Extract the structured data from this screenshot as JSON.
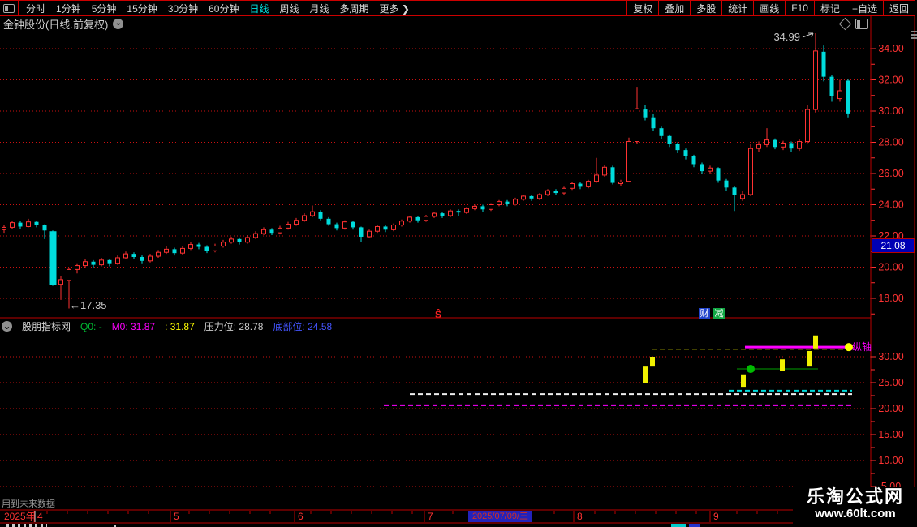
{
  "menu": {
    "left_items": [
      {
        "label": "分时",
        "active": false
      },
      {
        "label": "1分钟",
        "active": false
      },
      {
        "label": "5分钟",
        "active": false
      },
      {
        "label": "15分钟",
        "active": false
      },
      {
        "label": "30分钟",
        "active": false
      },
      {
        "label": "60分钟",
        "active": false
      },
      {
        "label": "日线",
        "active": true
      },
      {
        "label": "周线",
        "active": false
      },
      {
        "label": "月线",
        "active": false
      },
      {
        "label": "多周期",
        "active": false
      },
      {
        "label": "更多 ❯",
        "active": false
      }
    ],
    "right_items": [
      "复权",
      "叠加",
      "多股",
      "统计",
      "画线",
      "F10",
      "标记",
      "+自选",
      "返回"
    ]
  },
  "title_bar": {
    "title": "金钟股份(日线.前复权)",
    "chevron": "⌄"
  },
  "main_chart": {
    "axis": [
      {
        "label": "34.00",
        "value": 34
      },
      {
        "label": "32.00",
        "value": 32
      },
      {
        "label": "30.00",
        "value": 30
      },
      {
        "label": "28.00",
        "value": 28
      },
      {
        "label": "26.00",
        "value": 26
      },
      {
        "label": "24.00",
        "value": 24
      },
      {
        "label": "22.00",
        "value": 22
      },
      {
        "label": "20.00",
        "value": 20
      },
      {
        "label": "18.00",
        "value": 18
      }
    ],
    "price_tag": "21.08",
    "high_annotation": "34.99",
    "low_annotation": "←17.35",
    "event_marker": "Ŝ",
    "badges": [
      {
        "label": "财",
        "color": "#2244cc"
      },
      {
        "label": "减",
        "color": "#11a844"
      }
    ]
  },
  "indicator": {
    "name": "股朋指标网",
    "fields": [
      {
        "text": "Q0: -",
        "color": "#00bb33"
      },
      {
        "text": "M0: 31.87",
        "color": "#ff00ff"
      },
      {
        "text": ": 31.87",
        "color": "#ffff00"
      },
      {
        "text": "压力位: 28.78",
        "color": "#cccccc"
      },
      {
        "text": "底部位: 24.58",
        "color": "#4455ff"
      }
    ],
    "axis": [
      {
        "label": "30.00",
        "value": 30
      },
      {
        "label": "25.00",
        "value": 25
      },
      {
        "label": "20.00",
        "value": 20
      },
      {
        "label": "15.00",
        "value": 15
      },
      {
        "label": "10.00",
        "value": 10
      },
      {
        "label": "5.00",
        "value": 5
      }
    ],
    "side_label": "纵轴"
  },
  "footer": {
    "note": "用到未来数据",
    "year_label": "2025年",
    "months": [
      {
        "label": "4",
        "x": 46
      },
      {
        "label": "5",
        "x": 214
      },
      {
        "label": "6",
        "x": 367
      },
      {
        "label": "7",
        "x": 527
      },
      {
        "label": "8",
        "x": 711
      },
      {
        "label": "9",
        "x": 879
      }
    ],
    "highlight_date": "2025/07/09/三",
    "watermark_line1": "乐淘公式网",
    "watermark_line2": "www.60lt.com"
  },
  "chart_data": [
    {
      "type": "candlestick",
      "title": "金钟股份 日线 前复权 2025年4月-9月",
      "y_range": [
        17,
        35.5
      ],
      "grid_values": [
        34,
        32,
        30,
        28,
        26,
        24,
        22,
        20,
        18
      ],
      "up_color": "#ff3232",
      "down_color": "#00dcdc",
      "high": 34.99,
      "low": 17.35,
      "last_price_tag": 21.08,
      "candles": [
        [
          22.4,
          22.7,
          22.2,
          22.55
        ],
        [
          22.55,
          22.95,
          22.45,
          22.85
        ],
        [
          22.85,
          22.95,
          22.45,
          22.6
        ],
        [
          22.6,
          23.1,
          22.55,
          22.9
        ],
        [
          22.9,
          22.95,
          22.55,
          22.7
        ],
        [
          22.7,
          22.75,
          21.8,
          22.35
        ],
        [
          22.3,
          22.35,
          18.8,
          18.85,
          9
        ],
        [
          18.9,
          19.4,
          17.9,
          19.2
        ],
        [
          19.15,
          19.95,
          17.35,
          19.85
        ],
        [
          19.85,
          20.25,
          19.6,
          20.1
        ],
        [
          20.1,
          20.5,
          19.95,
          20.35
        ],
        [
          20.35,
          20.45,
          19.95,
          20.15
        ],
        [
          20.15,
          20.6,
          20.05,
          20.45
        ],
        [
          20.45,
          20.5,
          20.05,
          20.25
        ],
        [
          20.25,
          20.75,
          20.15,
          20.6
        ],
        [
          20.6,
          21.0,
          20.5,
          20.85
        ],
        [
          20.85,
          20.95,
          20.5,
          20.65
        ],
        [
          20.65,
          20.75,
          20.25,
          20.4
        ],
        [
          20.4,
          20.85,
          20.3,
          20.7
        ],
        [
          20.7,
          21.1,
          20.6,
          20.95
        ],
        [
          20.95,
          21.35,
          20.85,
          21.15
        ],
        [
          21.15,
          21.25,
          20.75,
          20.9
        ],
        [
          20.9,
          21.35,
          20.8,
          21.2
        ],
        [
          21.2,
          21.6,
          21.1,
          21.45
        ],
        [
          21.45,
          21.55,
          21.15,
          21.3
        ],
        [
          21.3,
          21.4,
          20.9,
          21.05
        ],
        [
          21.05,
          21.5,
          20.95,
          21.35
        ],
        [
          21.35,
          21.75,
          21.25,
          21.6
        ],
        [
          21.6,
          21.95,
          21.5,
          21.8
        ],
        [
          21.8,
          21.9,
          21.45,
          21.6
        ],
        [
          21.6,
          22.05,
          21.5,
          21.9
        ],
        [
          21.9,
          22.3,
          21.8,
          22.15
        ],
        [
          22.15,
          22.55,
          22.05,
          22.4
        ],
        [
          22.4,
          22.5,
          22.05,
          22.2
        ],
        [
          22.2,
          22.65,
          22.1,
          22.5
        ],
        [
          22.5,
          22.9,
          22.4,
          22.75
        ],
        [
          22.75,
          23.15,
          22.65,
          23.0
        ],
        [
          23.0,
          23.45,
          22.9,
          23.3
        ],
        [
          23.3,
          23.95,
          23.2,
          23.55
        ],
        [
          23.55,
          23.65,
          23.0,
          23.1
        ],
        [
          23.1,
          23.2,
          22.65,
          22.75
        ],
        [
          22.75,
          22.85,
          22.35,
          22.5
        ],
        [
          22.5,
          23.0,
          22.4,
          22.9
        ],
        [
          22.9,
          22.95,
          22.4,
          22.55
        ],
        [
          22.55,
          22.6,
          21.6,
          21.95
        ],
        [
          21.95,
          22.4,
          21.85,
          22.3
        ],
        [
          22.3,
          22.7,
          22.2,
          22.6
        ],
        [
          22.6,
          22.7,
          22.25,
          22.4
        ],
        [
          22.4,
          22.8,
          22.3,
          22.7
        ],
        [
          22.7,
          23.05,
          22.6,
          22.95
        ],
        [
          22.95,
          23.3,
          22.85,
          23.2
        ],
        [
          23.2,
          23.3,
          22.85,
          23.0
        ],
        [
          23.0,
          23.35,
          22.9,
          23.25
        ],
        [
          23.25,
          23.55,
          23.15,
          23.45
        ],
        [
          23.45,
          23.55,
          23.15,
          23.3
        ],
        [
          23.3,
          23.7,
          23.2,
          23.6
        ],
        [
          23.6,
          23.7,
          23.3,
          23.5
        ],
        [
          23.5,
          23.85,
          23.4,
          23.75
        ],
        [
          23.75,
          24.0,
          23.65,
          23.9
        ],
        [
          23.9,
          24.0,
          23.55,
          23.7
        ],
        [
          23.7,
          24.1,
          23.6,
          24.0
        ],
        [
          24.0,
          24.3,
          23.9,
          24.2
        ],
        [
          24.2,
          24.3,
          23.9,
          24.05
        ],
        [
          24.05,
          24.45,
          23.95,
          24.35
        ],
        [
          24.35,
          24.65,
          24.25,
          24.55
        ],
        [
          24.55,
          24.65,
          24.25,
          24.4
        ],
        [
          24.4,
          24.75,
          24.3,
          24.65
        ],
        [
          24.65,
          25.0,
          24.55,
          24.9
        ],
        [
          24.9,
          25.0,
          24.6,
          24.75
        ],
        [
          24.75,
          25.15,
          24.65,
          25.05
        ],
        [
          25.05,
          25.45,
          24.95,
          25.35
        ],
        [
          25.35,
          25.45,
          25.0,
          25.15
        ],
        [
          25.15,
          25.6,
          25.05,
          25.5
        ],
        [
          25.5,
          27.0,
          25.4,
          25.9
        ],
        [
          25.9,
          26.55,
          25.8,
          26.4
        ],
        [
          26.4,
          26.5,
          25.3,
          25.4
        ],
        [
          25.35,
          25.6,
          25.2,
          25.45
        ],
        [
          25.5,
          28.3,
          25.45,
          28.05
        ],
        [
          28.05,
          31.55,
          27.9,
          30.15
        ],
        [
          30.1,
          30.4,
          29.4,
          29.6
        ],
        [
          29.6,
          29.8,
          28.7,
          28.9
        ],
        [
          28.9,
          29.0,
          28.2,
          28.4
        ],
        [
          28.4,
          28.5,
          27.7,
          27.9
        ],
        [
          27.9,
          28.0,
          27.3,
          27.5
        ],
        [
          27.5,
          27.6,
          26.9,
          27.1
        ],
        [
          27.1,
          27.2,
          26.4,
          26.6
        ],
        [
          26.6,
          26.7,
          25.95,
          26.15
        ],
        [
          26.15,
          26.5,
          26.0,
          26.35
        ],
        [
          26.35,
          26.4,
          25.4,
          25.55
        ],
        [
          25.55,
          25.65,
          24.9,
          25.1
        ],
        [
          25.1,
          25.2,
          23.6,
          24.6
        ],
        [
          24.4,
          24.9,
          24.25,
          24.65
        ],
        [
          24.65,
          27.9,
          24.55,
          27.6
        ],
        [
          27.6,
          28.05,
          27.35,
          27.85
        ],
        [
          27.85,
          28.9,
          27.7,
          28.15
        ],
        [
          28.15,
          28.25,
          27.55,
          27.7
        ],
        [
          27.7,
          28.1,
          27.5,
          27.95
        ],
        [
          27.95,
          28.05,
          27.4,
          27.6
        ],
        [
          27.6,
          28.2,
          27.45,
          28.05
        ],
        [
          28.05,
          30.4,
          27.95,
          30.1
        ],
        [
          30.1,
          34.99,
          29.9,
          33.85
        ],
        [
          33.8,
          34.2,
          31.9,
          32.2
        ],
        [
          32.2,
          32.3,
          30.6,
          30.95
        ],
        [
          30.8,
          32.0,
          30.6,
          31.3
        ],
        [
          31.95,
          32.05,
          29.6,
          29.85
        ]
      ]
    },
    {
      "type": "overlay",
      "title": "股朋指标网 副图",
      "grid_values": [
        30,
        25,
        20,
        15,
        10,
        5
      ],
      "bars": [
        {
          "x": 795,
          "top": 28.1,
          "bottom": 24.85
        },
        {
          "x": 804,
          "top": 30.0,
          "bottom": 28.1
        },
        {
          "x": 916,
          "top": 26.6,
          "bottom": 24.2
        },
        {
          "x": 964,
          "top": 29.5,
          "bottom": 27.3
        },
        {
          "x": 997,
          "top": 31.1,
          "bottom": 28.1
        },
        {
          "x": 1005,
          "top": 34.1,
          "bottom": 31.6
        }
      ],
      "lines": [
        {
          "name": "yellow-dashed-level",
          "x1": 803,
          "x2": 1046,
          "v": 31.45,
          "color": "#ffff00",
          "dash": true,
          "w": 1
        },
        {
          "name": "m0-level",
          "x1": 918,
          "x2": 1046,
          "v": 31.85,
          "color": "#ff00ff",
          "dash": false,
          "w": 3
        },
        {
          "name": "green-level",
          "x1": 908,
          "x2": 1008,
          "v": 27.65,
          "color": "#00a000",
          "dash": false,
          "w": 1
        },
        {
          "name": "cyan-dashed-level",
          "x1": 898,
          "x2": 1050,
          "v": 23.45,
          "color": "#00dcdc",
          "dash": true,
          "w": 2
        },
        {
          "name": "white-dashed-level",
          "x1": 505,
          "x2": 1050,
          "v": 22.8,
          "color": "#eeeeee",
          "dash": true,
          "w": 2
        },
        {
          "name": "magenta-dashed-level",
          "x1": 473,
          "x2": 1050,
          "v": 20.65,
          "color": "#ff00ff",
          "dash": true,
          "w": 2
        }
      ],
      "dots": [
        {
          "x": 925,
          "v": 27.65,
          "color": "#00bb00",
          "r": 5
        },
        {
          "x": 1046,
          "v": 31.85,
          "color": "#ffff00",
          "r": 5
        }
      ]
    }
  ]
}
